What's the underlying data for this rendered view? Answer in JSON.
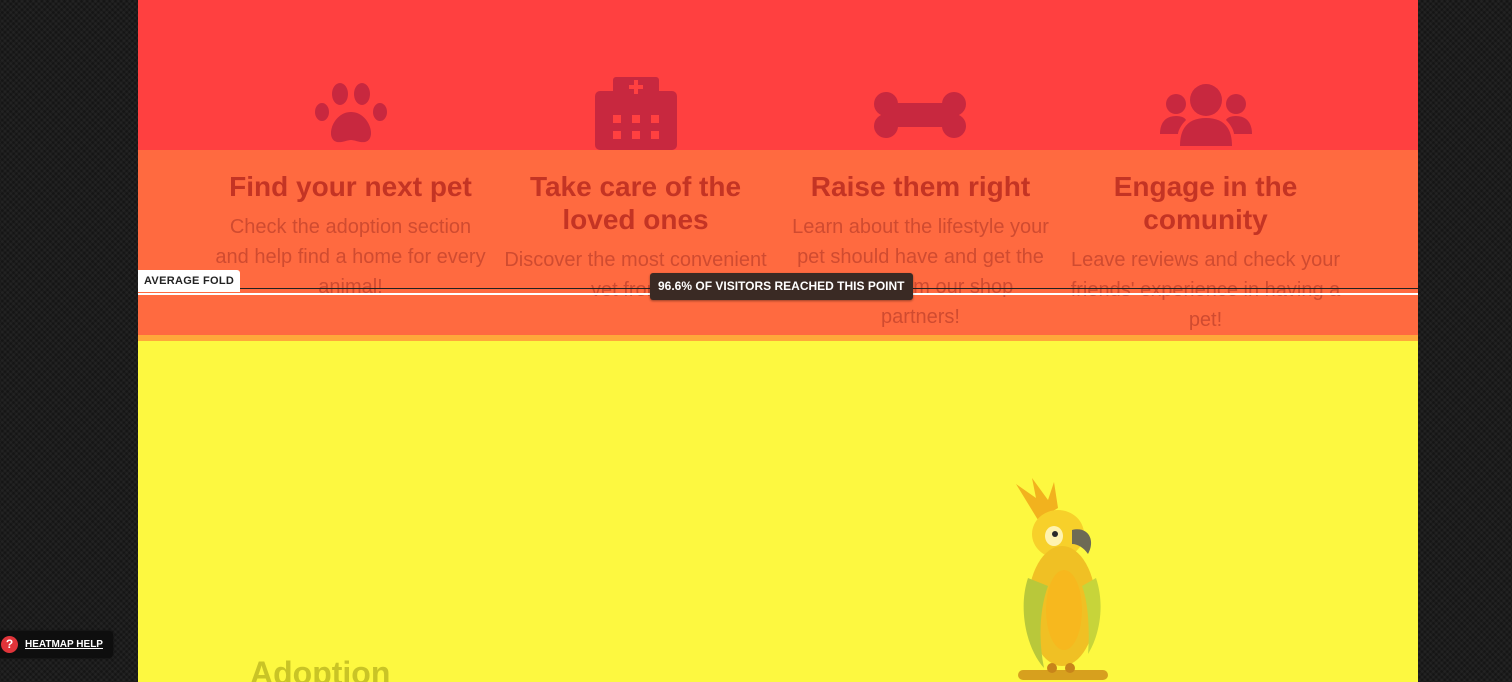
{
  "features": [
    {
      "icon": "paw-icon",
      "title": "Find your next pet",
      "lines": [
        "Check the adoption section",
        "and help find a home for every",
        "animal!"
      ]
    },
    {
      "icon": "hospital-icon",
      "title_lines": [
        "Take care of the",
        "loved ones"
      ],
      "lines": [
        "Discover the most convenient",
        "vet from o"
      ]
    },
    {
      "icon": "bone-icon",
      "title": "Raise them right",
      "lines": [
        "Learn about the lifestyle your",
        "pet should have and get the",
        "m from our shop",
        "partners!"
      ]
    },
    {
      "icon": "users-icon",
      "title_lines": [
        "Engage in the",
        "comunity"
      ],
      "lines": [
        "Leave reviews and check your",
        "friends' experience in having a",
        "pet!"
      ]
    }
  ],
  "fold": {
    "label": "AVERAGE FOLD",
    "reach": "96.6% OF VISITORS REACHED THIS POINT"
  },
  "adoption": {
    "title": "Adoption"
  },
  "help": {
    "icon_glyph": "?",
    "label": "HEATMAP HELP"
  },
  "colors": {
    "band_red": "#ff4040",
    "band_orange": "#ff6a40",
    "band_yellow": "#fdf840",
    "icon_fill": "#c8283f"
  }
}
